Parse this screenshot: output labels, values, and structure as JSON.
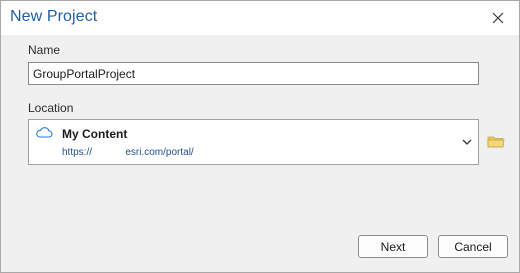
{
  "dialog": {
    "title": "New Project",
    "close_icon": "close-icon"
  },
  "name_field": {
    "label": "Name",
    "value": "GroupPortalProject"
  },
  "location_field": {
    "label": "Location",
    "selected_title": "My Content",
    "selected_url": "https://            esri.com/portal/",
    "icon": "cloud-icon",
    "dropdown_icon": "chevron-down-icon",
    "browse_icon": "folder-icon"
  },
  "buttons": {
    "next_label": "Next",
    "cancel_label": "Cancel"
  },
  "colors": {
    "title": "#1f5fa8",
    "url": "#1f4f8f",
    "cloud": "#2c7fd0",
    "folder": "#e8c65c"
  }
}
